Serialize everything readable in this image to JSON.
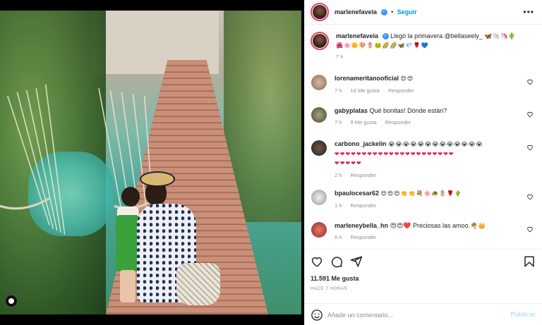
{
  "post": {
    "username": "marlenefavela",
    "follow_label": "Seguir",
    "more_label": "•••"
  },
  "caption": {
    "username": "marlenefavela",
    "text": "Llegó la primavera @bellaseely_ 🦋🐚🦄🌵",
    "emoji_line": "🌺🌸🌼🍄🌷🐸🌈🌈🦋💎🌹💙",
    "time": "7 h"
  },
  "comments": [
    {
      "username": "lorenameritanooficial",
      "text": "😍😍",
      "time": "7 h",
      "likes": "16 Me gusta",
      "reply": "Responder"
    },
    {
      "username": "gabyplatas",
      "text": "Qué bonitas! Dónde están?",
      "time": "7 h",
      "likes": "9 Me gusta",
      "reply": "Responder"
    },
    {
      "username": "carbono_jackelin",
      "text": "😭😭😭😭😭😭😭😭😭😭😭😭😭",
      "hearts": "❤❤❤❤❤❤❤❤❤❤❤❤❤❤❤❤❤❤❤❤❤❤",
      "hearts2": "❤❤❤❤❤",
      "time": "2 h",
      "likes": "",
      "reply": "Responder"
    },
    {
      "username": "bpaulocesar62",
      "text": "😍😍😍👏👏💐🌸🐢🌷🌹🌵",
      "time": "1 h",
      "likes": "",
      "reply": "Responder"
    },
    {
      "username": "marleneybella_hn",
      "text": "😍😍❤️ Preciosas las amoo.🌴👑",
      "time": "6 h",
      "likes": "",
      "reply": "Responder"
    }
  ],
  "footer": {
    "likes": "11.591 Me gusta",
    "when": "HACE 7 HORAS",
    "comment_placeholder": "Añade un comentario...",
    "publish_label": "Publicar"
  },
  "colors": {
    "link": "#0095f6",
    "verified": "#3897f0",
    "muted": "#8e8e8e",
    "publish_disabled": "#b2dffc"
  }
}
